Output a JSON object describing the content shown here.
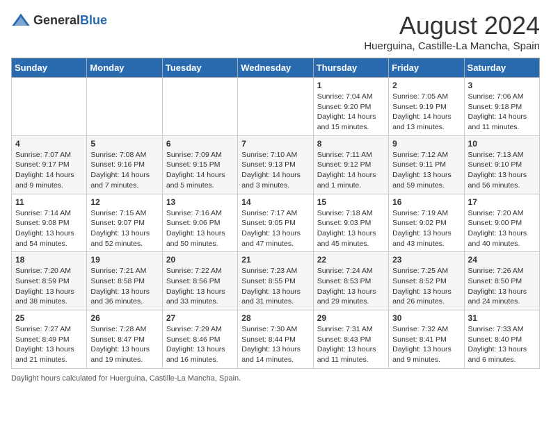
{
  "header": {
    "logo_general": "General",
    "logo_blue": "Blue",
    "month_title": "August 2024",
    "location": "Huerguina, Castille-La Mancha, Spain"
  },
  "days_of_week": [
    "Sunday",
    "Monday",
    "Tuesday",
    "Wednesday",
    "Thursday",
    "Friday",
    "Saturday"
  ],
  "footer": {
    "daylight_note": "Daylight hours"
  },
  "weeks": [
    {
      "days": [
        {
          "num": "",
          "info": ""
        },
        {
          "num": "",
          "info": ""
        },
        {
          "num": "",
          "info": ""
        },
        {
          "num": "",
          "info": ""
        },
        {
          "num": "1",
          "info": "Sunrise: 7:04 AM\nSunset: 9:20 PM\nDaylight: 14 hours and 15 minutes."
        },
        {
          "num": "2",
          "info": "Sunrise: 7:05 AM\nSunset: 9:19 PM\nDaylight: 14 hours and 13 minutes."
        },
        {
          "num": "3",
          "info": "Sunrise: 7:06 AM\nSunset: 9:18 PM\nDaylight: 14 hours and 11 minutes."
        }
      ]
    },
    {
      "days": [
        {
          "num": "4",
          "info": "Sunrise: 7:07 AM\nSunset: 9:17 PM\nDaylight: 14 hours and 9 minutes."
        },
        {
          "num": "5",
          "info": "Sunrise: 7:08 AM\nSunset: 9:16 PM\nDaylight: 14 hours and 7 minutes."
        },
        {
          "num": "6",
          "info": "Sunrise: 7:09 AM\nSunset: 9:15 PM\nDaylight: 14 hours and 5 minutes."
        },
        {
          "num": "7",
          "info": "Sunrise: 7:10 AM\nSunset: 9:13 PM\nDaylight: 14 hours and 3 minutes."
        },
        {
          "num": "8",
          "info": "Sunrise: 7:11 AM\nSunset: 9:12 PM\nDaylight: 14 hours and 1 minute."
        },
        {
          "num": "9",
          "info": "Sunrise: 7:12 AM\nSunset: 9:11 PM\nDaylight: 13 hours and 59 minutes."
        },
        {
          "num": "10",
          "info": "Sunrise: 7:13 AM\nSunset: 9:10 PM\nDaylight: 13 hours and 56 minutes."
        }
      ]
    },
    {
      "days": [
        {
          "num": "11",
          "info": "Sunrise: 7:14 AM\nSunset: 9:08 PM\nDaylight: 13 hours and 54 minutes."
        },
        {
          "num": "12",
          "info": "Sunrise: 7:15 AM\nSunset: 9:07 PM\nDaylight: 13 hours and 52 minutes."
        },
        {
          "num": "13",
          "info": "Sunrise: 7:16 AM\nSunset: 9:06 PM\nDaylight: 13 hours and 50 minutes."
        },
        {
          "num": "14",
          "info": "Sunrise: 7:17 AM\nSunset: 9:05 PM\nDaylight: 13 hours and 47 minutes."
        },
        {
          "num": "15",
          "info": "Sunrise: 7:18 AM\nSunset: 9:03 PM\nDaylight: 13 hours and 45 minutes."
        },
        {
          "num": "16",
          "info": "Sunrise: 7:19 AM\nSunset: 9:02 PM\nDaylight: 13 hours and 43 minutes."
        },
        {
          "num": "17",
          "info": "Sunrise: 7:20 AM\nSunset: 9:00 PM\nDaylight: 13 hours and 40 minutes."
        }
      ]
    },
    {
      "days": [
        {
          "num": "18",
          "info": "Sunrise: 7:20 AM\nSunset: 8:59 PM\nDaylight: 13 hours and 38 minutes."
        },
        {
          "num": "19",
          "info": "Sunrise: 7:21 AM\nSunset: 8:58 PM\nDaylight: 13 hours and 36 minutes."
        },
        {
          "num": "20",
          "info": "Sunrise: 7:22 AM\nSunset: 8:56 PM\nDaylight: 13 hours and 33 minutes."
        },
        {
          "num": "21",
          "info": "Sunrise: 7:23 AM\nSunset: 8:55 PM\nDaylight: 13 hours and 31 minutes."
        },
        {
          "num": "22",
          "info": "Sunrise: 7:24 AM\nSunset: 8:53 PM\nDaylight: 13 hours and 29 minutes."
        },
        {
          "num": "23",
          "info": "Sunrise: 7:25 AM\nSunset: 8:52 PM\nDaylight: 13 hours and 26 minutes."
        },
        {
          "num": "24",
          "info": "Sunrise: 7:26 AM\nSunset: 8:50 PM\nDaylight: 13 hours and 24 minutes."
        }
      ]
    },
    {
      "days": [
        {
          "num": "25",
          "info": "Sunrise: 7:27 AM\nSunset: 8:49 PM\nDaylight: 13 hours and 21 minutes."
        },
        {
          "num": "26",
          "info": "Sunrise: 7:28 AM\nSunset: 8:47 PM\nDaylight: 13 hours and 19 minutes."
        },
        {
          "num": "27",
          "info": "Sunrise: 7:29 AM\nSunset: 8:46 PM\nDaylight: 13 hours and 16 minutes."
        },
        {
          "num": "28",
          "info": "Sunrise: 7:30 AM\nSunset: 8:44 PM\nDaylight: 13 hours and 14 minutes."
        },
        {
          "num": "29",
          "info": "Sunrise: 7:31 AM\nSunset: 8:43 PM\nDaylight: 13 hours and 11 minutes."
        },
        {
          "num": "30",
          "info": "Sunrise: 7:32 AM\nSunset: 8:41 PM\nDaylight: 13 hours and 9 minutes."
        },
        {
          "num": "31",
          "info": "Sunrise: 7:33 AM\nSunset: 8:40 PM\nDaylight: 13 hours and 6 minutes."
        }
      ]
    }
  ]
}
